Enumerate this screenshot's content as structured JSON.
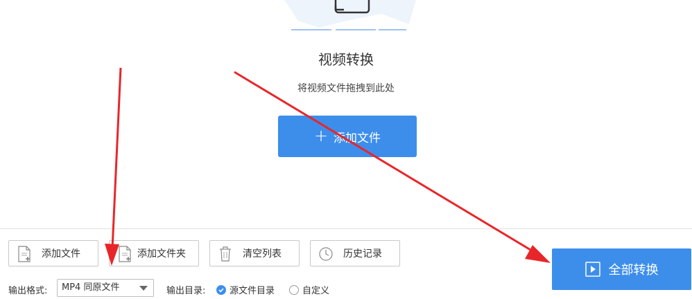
{
  "main": {
    "title": "视频转换",
    "subtitle": "将视频文件拖拽到此处",
    "add_file_button": "添加文件"
  },
  "toolbar": {
    "add_file": "添加文件",
    "add_folder": "添加文件夹",
    "clear_list": "清空列表",
    "history": "历史记录",
    "convert_all": "全部转换"
  },
  "settings": {
    "format_label": "输出格式:",
    "format_value": "MP4 同原文件",
    "dir_label": "输出目录:",
    "dir_option_source": "源文件目录",
    "dir_option_custom": "自定义",
    "dir_selected": "源文件目录"
  },
  "colors": {
    "accent": "#3d8eeb",
    "annotation_arrow": "#e8262a"
  }
}
